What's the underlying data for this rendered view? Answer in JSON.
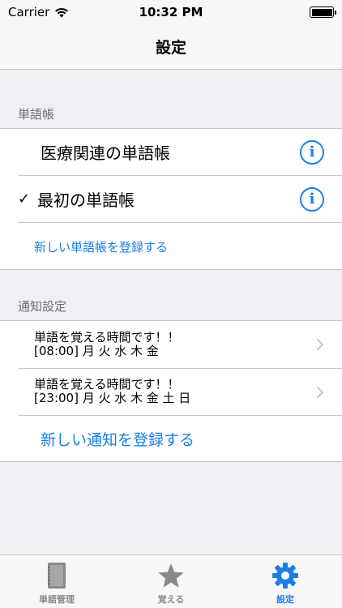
{
  "status_bar": {
    "carrier": "Carrier",
    "time": "10:32 PM"
  },
  "nav": {
    "title": "設定"
  },
  "wordbooks": {
    "header": "単語帳",
    "items": [
      {
        "label": "医療関連の単語帳",
        "checked": false
      },
      {
        "label": "最初の単語帳",
        "checked": true
      }
    ],
    "check_mark": "✓",
    "info_glyph": "i",
    "add_label": "新しい単語帳を登録する"
  },
  "notifications": {
    "header": "通知設定",
    "items": [
      {
        "message": "単語を覚える時間です！！",
        "schedule": "[08:00] 月 火 水 木 金"
      },
      {
        "message": "単語を覚える時間です！！",
        "schedule": "[23:00] 月 火 水 木 金 土 日"
      }
    ],
    "add_label": "新しい通知を登録する"
  },
  "tabs": [
    {
      "label": "単語管理",
      "icon": "notebook-icon",
      "active": false
    },
    {
      "label": "覚える",
      "icon": "star-icon",
      "active": false
    },
    {
      "label": "設定",
      "icon": "gear-icon",
      "active": true
    }
  ],
  "colors": {
    "accent": "#1a7ee8",
    "inactive_tab": "#8a8a8a",
    "background": "#efeff4"
  }
}
